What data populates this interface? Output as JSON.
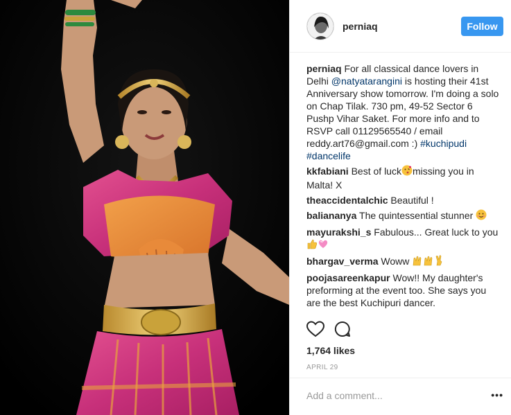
{
  "post": {
    "username": "perniaq",
    "follow_label": "Follow",
    "caption": {
      "user": "perniaq",
      "text_1": "For all classical dance lovers in Delhi",
      "mention": "@natyatarangini",
      "text_2": "is hosting their 41st Anniversary show tomorrow. I'm doing a solo on Chap Tilak. 730 pm, 49-52 Sector 6 Pushp Vihar Saket. For more info and to RSVP call 01129565540 / email reddy.art76@gmail.com :)",
      "hashtag_1": "#kuchipudi",
      "hashtag_2": "#dancelife"
    },
    "comments": [
      {
        "user": "kkfabiani",
        "text_a": "Best of luck",
        "emoji": "kiss-emoji",
        "text_b": "missing you in Malta! X"
      },
      {
        "user": "theaccidentalchic",
        "text": "Beautiful !"
      },
      {
        "user": "baliananya",
        "text": "The quintessential stunner",
        "emoji": "smile-emoji"
      },
      {
        "user": "mayurakshi_s",
        "text": "Fabulous... Great luck to you",
        "emoji": "thumbs-heart-emoji"
      },
      {
        "user": "bhargav_verma",
        "text": "Woww",
        "emoji": "hands-emoji"
      },
      {
        "user": "poojasareenkapur",
        "text": "Wow!! My daughter's preforming at the event too. She says you are the best Kuchipuri dancer."
      }
    ],
    "likes": "1,764 likes",
    "date": "APRIL 29",
    "add_comment_placeholder": "Add a comment...",
    "more_label": "•••",
    "icons": [
      "heart-icon",
      "comment-icon",
      "more-options-icon"
    ],
    "colors": {
      "follow": "#3897f0",
      "link": "#003569",
      "muted": "#999999"
    }
  }
}
